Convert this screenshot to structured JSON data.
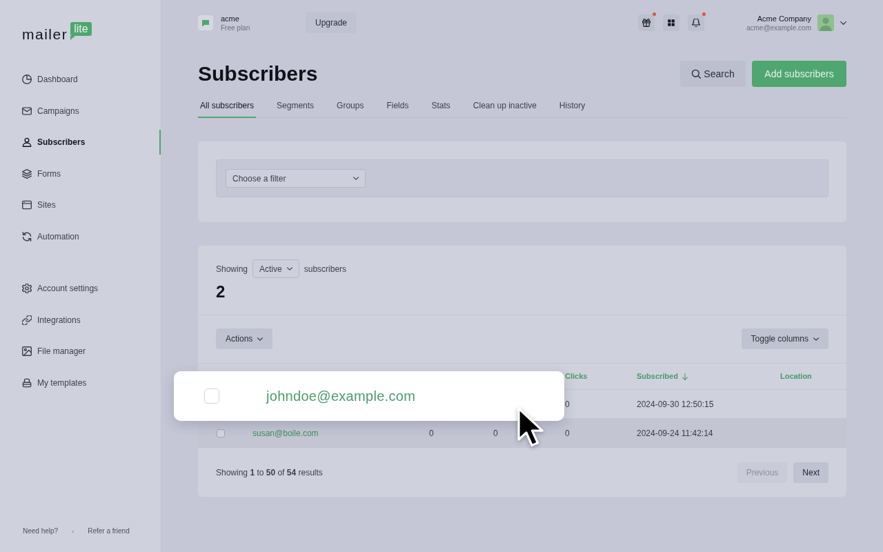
{
  "sidebar": {
    "logo": {
      "text": "mailer",
      "badge": "lite"
    },
    "primary": [
      {
        "label": "Dashboard",
        "kind": "pie",
        "selected": false
      },
      {
        "label": "Campaigns",
        "kind": "envelope",
        "selected": false
      },
      {
        "label": "Subscribers",
        "kind": "person",
        "selected": true
      },
      {
        "label": "Forms",
        "kind": "layers",
        "selected": false
      },
      {
        "label": "Sites",
        "kind": "browser",
        "selected": false
      },
      {
        "label": "Automation",
        "kind": "refresh",
        "selected": false
      }
    ],
    "secondary": [
      {
        "label": "Account settings",
        "kind": "gear",
        "selected": false
      },
      {
        "label": "Integrations",
        "kind": "link",
        "selected": false
      },
      {
        "label": "File manager",
        "kind": "image",
        "selected": false
      },
      {
        "label": "My templates",
        "kind": "tray",
        "selected": false
      }
    ],
    "footer": [
      "Need help?",
      "Refer a friend"
    ]
  },
  "top_bar": {
    "workspace": {
      "name": "acme",
      "plan": "Free plan"
    },
    "upgrade": "Upgrade",
    "icons": [
      {
        "kind": "gift",
        "dot": true
      },
      {
        "kind": "grid",
        "dot": false
      },
      {
        "kind": "bell",
        "dot": true
      }
    ],
    "account": {
      "name": "Acme Company",
      "email": "acme@example.com"
    }
  },
  "page": {
    "title": "Subscribers",
    "search": "Search",
    "add": "Add subscribers"
  },
  "tabs": [
    {
      "label": "All subscribers",
      "selected": true
    },
    {
      "label": "Segments",
      "selected": false
    },
    {
      "label": "Groups",
      "selected": false
    },
    {
      "label": "Fields",
      "selected": false
    },
    {
      "label": "Stats",
      "selected": false
    },
    {
      "label": "Clean up inactive",
      "selected": false
    },
    {
      "label": "History",
      "selected": false
    }
  ],
  "filter": {
    "placeholder": "Choose a filter"
  },
  "summary": {
    "prefix": "Showing",
    "status": "Active",
    "suffix": "subscribers",
    "count": "2"
  },
  "toolbar": {
    "actions": "Actions",
    "toggle": "Toggle columns"
  },
  "table": {
    "columns": [
      {
        "label": "Clicks",
        "sorted": false
      },
      {
        "label": "Subscribed",
        "sorted": true
      },
      {
        "label": "Location",
        "sorted": false
      }
    ],
    "rows": [
      {
        "clicks": "0",
        "subscribed": "2024-09-30 12:50:15",
        "hovered": false
      },
      {
        "checked": false,
        "email": "susan@boile.com",
        "column_3": "0",
        "column_4": "0",
        "clicks": "0",
        "subscribed": "2024-09-24 11:42:14",
        "hovered": true
      }
    ]
  },
  "pagination": {
    "summary": "Showing **1** to **50** of **54** results",
    "previous": {
      "label": "Previous",
      "disabled": true
    },
    "next": {
      "label": "Next",
      "disabled": false
    }
  },
  "highlight_card": {
    "checked": false,
    "email": "johndoe@example.com"
  }
}
